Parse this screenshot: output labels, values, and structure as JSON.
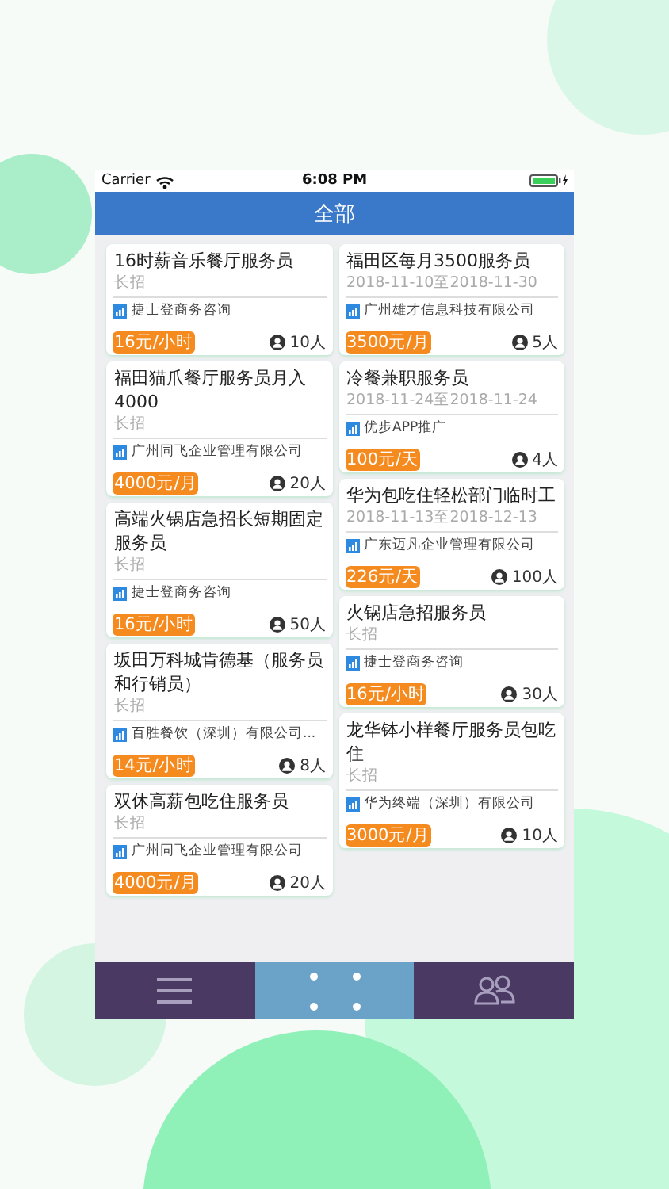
{
  "status_bar": {
    "carrier": "Carrier",
    "time": "6:08 PM"
  },
  "header": {
    "title": "全部"
  },
  "columns": [
    {
      "cards": [
        {
          "title": "16时薪音乐餐厅服务员",
          "subtitle": "长招",
          "company": "捷士登商务咨询",
          "salary": "16元/小时",
          "count": "10人"
        },
        {
          "title": "福田猫爪餐厅服务员月入4000",
          "subtitle": "长招",
          "company": "广州同飞企业管理有限公司",
          "salary": "4000元/月",
          "count": "20人"
        },
        {
          "title": "高端火锅店急招长短期固定服务员",
          "subtitle": "长招",
          "company": "捷士登商务咨询",
          "salary": "16元/小时",
          "count": "50人"
        },
        {
          "title": "坂田万科城肯德基（服务员和行销员）",
          "subtitle": "长招",
          "company": "百胜餐饮（深圳）有限公司...",
          "salary": "14元/小时",
          "count": "8人"
        },
        {
          "title": "双休高薪包吃住服务员",
          "subtitle": "长招",
          "company": "广州同飞企业管理有限公司",
          "salary": "4000元/月",
          "count": "20人"
        }
      ]
    },
    {
      "cards": [
        {
          "title": "福田区每月3500服务员",
          "subtitle": "2018-11-10至2018-11-30",
          "company": "广州雄才信息科技有限公司",
          "salary": "3500元/月",
          "count": "5人"
        },
        {
          "title": "冷餐兼职服务员",
          "subtitle": "2018-11-24至2018-11-24",
          "company": "优步APP推广",
          "salary": "100元/天",
          "count": "4人"
        },
        {
          "title": "华为包吃住轻松部门临时工",
          "subtitle": "2018-11-13至2018-12-13",
          "company": "广东迈凡企业管理有限公司",
          "salary": "226元/天",
          "count": "100人"
        },
        {
          "title": "火锅店急招服务员",
          "subtitle": "长招",
          "company": "捷士登商务咨询",
          "salary": "16元/小时",
          "count": "30人"
        },
        {
          "title": "龙华钵小样餐厅服务员包吃住",
          "subtitle": "长招",
          "company": "华为终端（深圳）有限公司",
          "salary": "3000元/月",
          "count": "10人"
        }
      ]
    }
  ],
  "tabs": [
    {
      "kind": "menu",
      "selected": false
    },
    {
      "kind": "grid",
      "selected": true
    },
    {
      "kind": "people",
      "selected": false
    }
  ]
}
